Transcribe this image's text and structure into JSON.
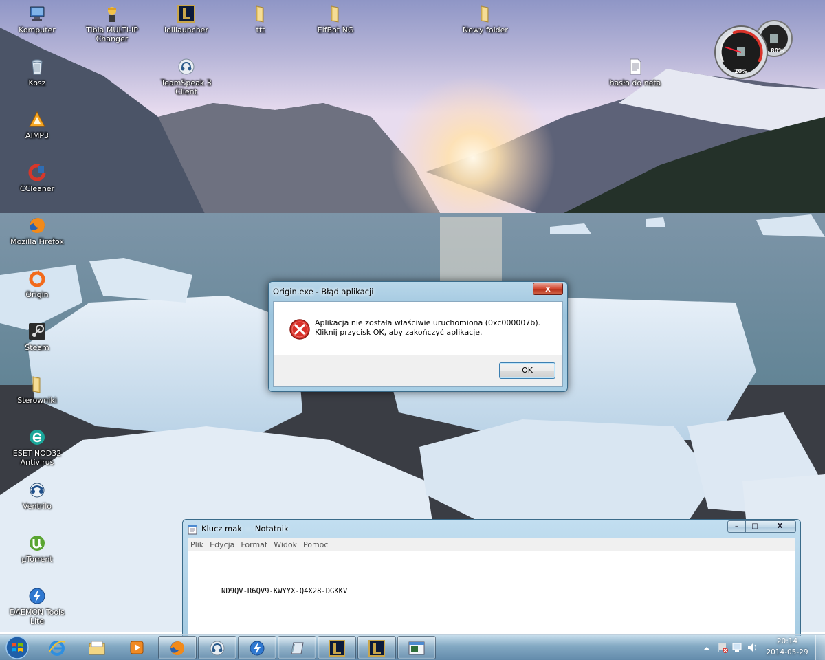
{
  "desktop": {
    "icons": [
      {
        "label": "Komputer",
        "icon": "computer-icon"
      },
      {
        "label": "Tibia MULTI-IP Changer",
        "icon": "tibia-icon"
      },
      {
        "label": "lolilauncher",
        "icon": "league-icon"
      },
      {
        "label": "ttt",
        "icon": "folder-icon"
      },
      {
        "label": "ElfBot NG",
        "icon": "folder-icon"
      },
      {
        "label": "Nowy folder",
        "icon": "folder-icon"
      },
      {
        "label": "Kosz",
        "icon": "recycle-bin-icon"
      },
      {
        "label": "TeamSpeak 3 Client",
        "icon": "teamspeak-icon"
      },
      {
        "label": "hasło do neta",
        "icon": "text-file-icon"
      },
      {
        "label": "AIMP3",
        "icon": "aimp-icon"
      },
      {
        "label": "CCleaner",
        "icon": "ccleaner-icon"
      },
      {
        "label": "Mozilla Firefox",
        "icon": "firefox-icon"
      },
      {
        "label": "Origin",
        "icon": "origin-icon"
      },
      {
        "label": "Steam",
        "icon": "steam-icon"
      },
      {
        "label": "Sterowniki",
        "icon": "folder-icon"
      },
      {
        "label": "ESET NOD32 Antivirus",
        "icon": "eset-icon"
      },
      {
        "label": "Ventrilo",
        "icon": "ventrilo-icon"
      },
      {
        "label": "µTorrent",
        "icon": "utorrent-icon"
      },
      {
        "label": "DAEMON Tools Lite",
        "icon": "daemon-tools-icon"
      }
    ]
  },
  "gadget": {
    "cpu_percent": "20%",
    "ram_percent": "80%",
    "cpu_level": 0.2,
    "ram_level": 0.8
  },
  "dialog": {
    "title": "Origin.exe - Błąd aplikacji",
    "close_label": "x",
    "message": "Aplikacja nie została właściwie uruchomiona (0xc000007b). Kliknij przycisk OK, aby zakończyć aplikację.",
    "ok_label": "OK"
  },
  "notepad": {
    "title": "Klucz mak — Notatnik",
    "menu": [
      "Plik",
      "Edycja",
      "Format",
      "Widok",
      "Pomoc"
    ],
    "content": "ND9QV-R6QV9-KWYYX-Q4X28-DGKKV",
    "min_label": "–",
    "max_label": "□",
    "close_label": "X"
  },
  "taskbar": {
    "items": [
      {
        "name": "internet-explorer",
        "icon": "internet-explorer-icon",
        "active": false
      },
      {
        "name": "file-explorer",
        "icon": "folder-library-icon",
        "active": false
      },
      {
        "name": "media-player",
        "icon": "media-player-icon",
        "active": false
      },
      {
        "name": "firefox",
        "icon": "firefox-icon",
        "active": true
      },
      {
        "name": "teamspeak",
        "icon": "teamspeak-icon",
        "active": true
      },
      {
        "name": "daemon-tools",
        "icon": "daemon-tools-icon",
        "active": true
      },
      {
        "name": "notepad",
        "icon": "notepad-icon",
        "active": true
      },
      {
        "name": "lolilauncher-1",
        "icon": "league-icon",
        "active": true
      },
      {
        "name": "lolilauncher-2",
        "icon": "league-icon",
        "active": true
      },
      {
        "name": "task-window",
        "icon": "window-icon",
        "active": true
      }
    ],
    "clock": {
      "time": "20:14",
      "date": "2014-05-29"
    }
  }
}
